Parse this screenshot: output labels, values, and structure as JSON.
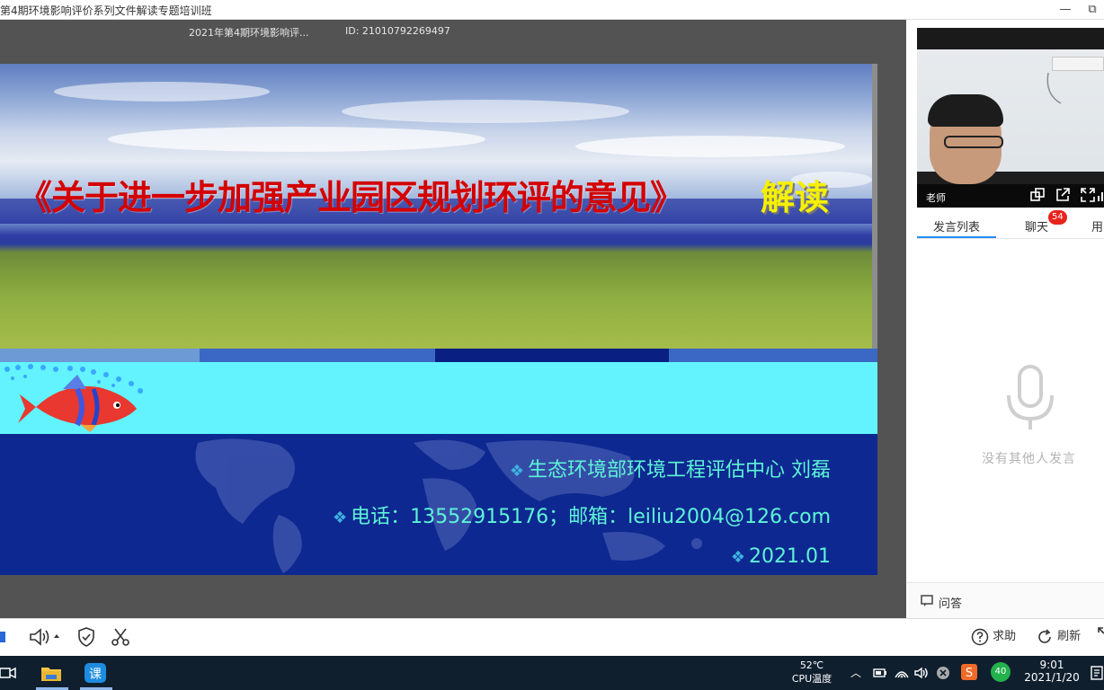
{
  "window": {
    "title": "第4期环境影响评价系列文件解读专题培训班",
    "buttons": [
      "—",
      "⧉"
    ]
  },
  "meeting": {
    "name": "2021年第4期环境影响评...",
    "id_text": "ID:  21010792269497"
  },
  "slide": {
    "title_main": "《关于进一步加强产业园区规划环评的意见》",
    "title_highlight": "解读",
    "author_line": "生态环境部环境工程评估中心 刘磊",
    "contact_line": "电话：13552915176；邮箱：leiliu2004@126.com",
    "date_line": "2021.01",
    "bullet": "❖"
  },
  "panel": {
    "video": {
      "label": "老师"
    },
    "tabs": [
      {
        "label": "发言列表",
        "active": true
      },
      {
        "label": "聊天",
        "badge": "54"
      },
      {
        "label": "用"
      }
    ],
    "empty_message": "没有其他人发言",
    "qa_label": "问答"
  },
  "toolbar": {
    "help_label": "求助",
    "refresh_label": "刷新"
  },
  "taskbar": {
    "temperature": "52℃",
    "temperature_label": "CPU温度",
    "badge_40": "40",
    "time": "9:01",
    "date": "2021/1/20"
  },
  "colors": {
    "slide_title": "#d40000",
    "slide_highlight": "#f6f000",
    "cyan_band": "#62f3ff",
    "blue_band": "#0e2891",
    "slide_text": "#5df4d6",
    "accent": "#2a8cf0",
    "badge": "#e8231d"
  }
}
